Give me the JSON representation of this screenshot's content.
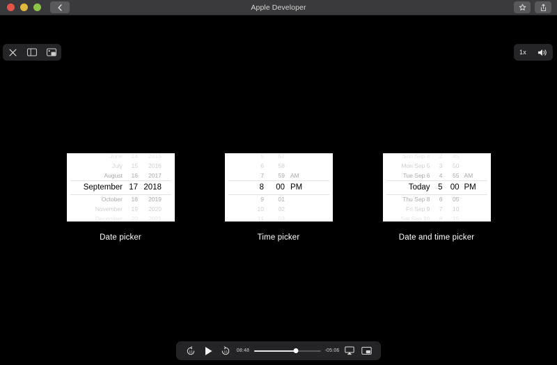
{
  "window": {
    "title": "Apple Developer",
    "traffic_lights": [
      "close",
      "minimize",
      "maximize"
    ],
    "back_icon": "chevron-left-icon",
    "favorite_icon": "star-icon",
    "share_icon": "share-icon"
  },
  "toolbar": {
    "close_icon": "close-icon",
    "sidebar_icon": "sidebar-icon",
    "thumbnails_icon": "thumbnails-icon",
    "playback_rate": "1x",
    "volume_icon": "volume-icon"
  },
  "content": {
    "pickers": [
      {
        "caption": "Date picker",
        "type": "date",
        "columns": 3,
        "rows": [
          {
            "dim": "d3",
            "cells": [
              "June",
              "14",
              "2015"
            ]
          },
          {
            "dim": "d2",
            "cells": [
              "July",
              "15",
              "2016"
            ]
          },
          {
            "dim": "d1",
            "cells": [
              "August",
              "16",
              "2017"
            ]
          },
          {
            "dim": "sel",
            "cells": [
              "September",
              "17",
              "2018"
            ]
          },
          {
            "dim": "d1",
            "cells": [
              "October",
              "18",
              "2019"
            ]
          },
          {
            "dim": "d2",
            "cells": [
              "November",
              "19",
              "2020"
            ]
          },
          {
            "dim": "d3",
            "cells": [
              "December",
              "20",
              "2021"
            ]
          }
        ]
      },
      {
        "caption": "Time picker",
        "type": "time",
        "columns": 3,
        "rows": [
          {
            "dim": "d3",
            "cells": [
              "5",
              "57",
              ""
            ]
          },
          {
            "dim": "d2",
            "cells": [
              "6",
              "58",
              ""
            ]
          },
          {
            "dim": "d1",
            "cells": [
              "7",
              "59",
              "AM"
            ]
          },
          {
            "dim": "sel",
            "cells": [
              "8",
              "00",
              "PM"
            ]
          },
          {
            "dim": "d1",
            "cells": [
              "9",
              "01",
              ""
            ]
          },
          {
            "dim": "d2",
            "cells": [
              "10",
              "02",
              ""
            ]
          },
          {
            "dim": "d3",
            "cells": [
              "11",
              "03",
              ""
            ]
          }
        ]
      },
      {
        "caption": "Date and time picker",
        "type": "dt",
        "columns": 4,
        "rows": [
          {
            "dim": "d3",
            "cells": [
              "Sun Sep 4",
              "2",
              "45",
              ""
            ]
          },
          {
            "dim": "d2",
            "cells": [
              "Mon Sep 5",
              "3",
              "50",
              ""
            ]
          },
          {
            "dim": "d1",
            "cells": [
              "Tue Sep 6",
              "4",
              "55",
              "AM"
            ]
          },
          {
            "dim": "sel",
            "cells": [
              "Today",
              "5",
              "00",
              "PM"
            ]
          },
          {
            "dim": "d1",
            "cells": [
              "Thu Sep 8",
              "6",
              "05",
              ""
            ]
          },
          {
            "dim": "d2",
            "cells": [
              "Fri Sep 9",
              "7",
              "10",
              ""
            ]
          },
          {
            "dim": "d3",
            "cells": [
              "Sat Sep 10",
              "8",
              "15",
              ""
            ]
          }
        ]
      }
    ]
  },
  "player": {
    "skip_back_icon": "skip-back-15-icon",
    "play_icon": "play-icon",
    "skip_forward_icon": "skip-forward-15-icon",
    "elapsed": "08:48",
    "remaining": "-05:06",
    "progress_percent": 63,
    "airplay_icon": "airplay-icon",
    "pip_icon": "picture-in-picture-icon"
  },
  "colors": {
    "titlebar_bg": "#3a3a3c",
    "stage_bg": "#000000",
    "picker_bg": "#ffffff",
    "accent_text": "#ffffff"
  }
}
